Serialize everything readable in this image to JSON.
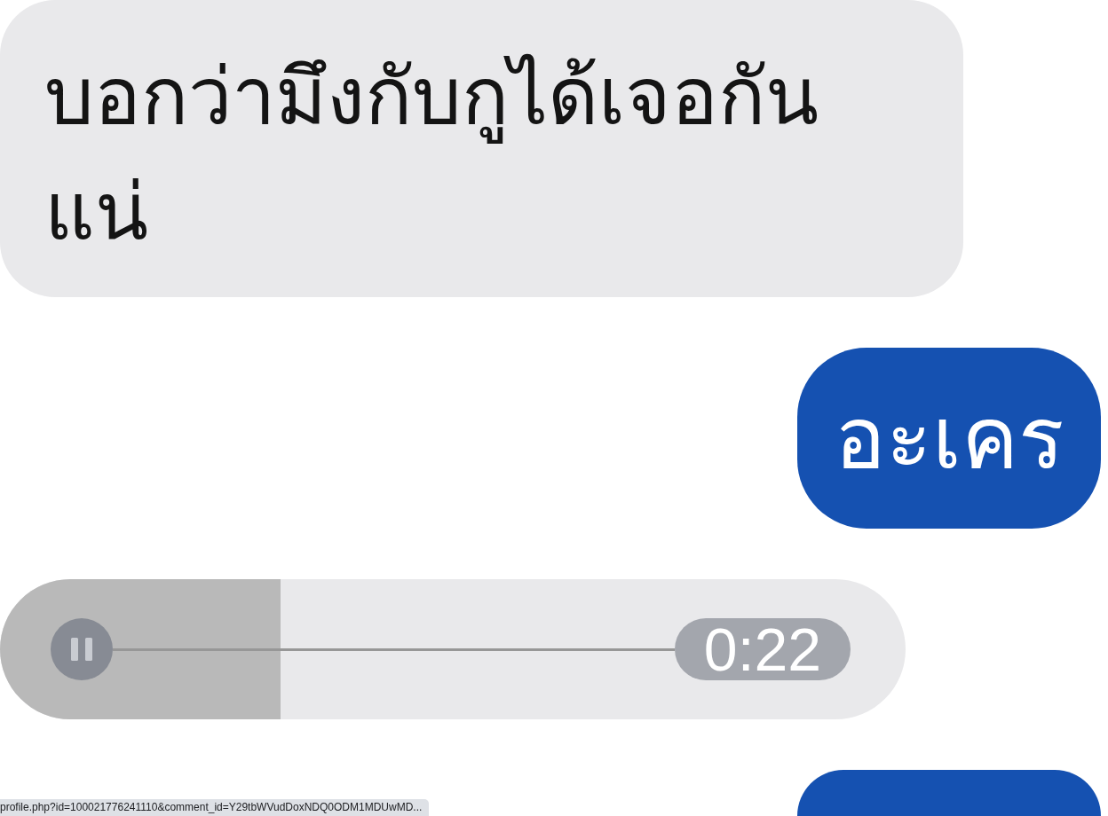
{
  "messages": [
    {
      "kind": "received",
      "text": "บอกว่ามึงกับกูได้เจอกันแน่"
    },
    {
      "kind": "sent",
      "text": "อะเคร"
    },
    {
      "kind": "audio",
      "playing": true,
      "level": 0.31,
      "duration": "0:22"
    },
    {
      "kind": "sent"
    }
  ],
  "status_bar": {
    "url": "profile.php?id=100021776241110&comment_id=Y29tbWVudDoxNDQ0ODM1MDUwMD..."
  }
}
